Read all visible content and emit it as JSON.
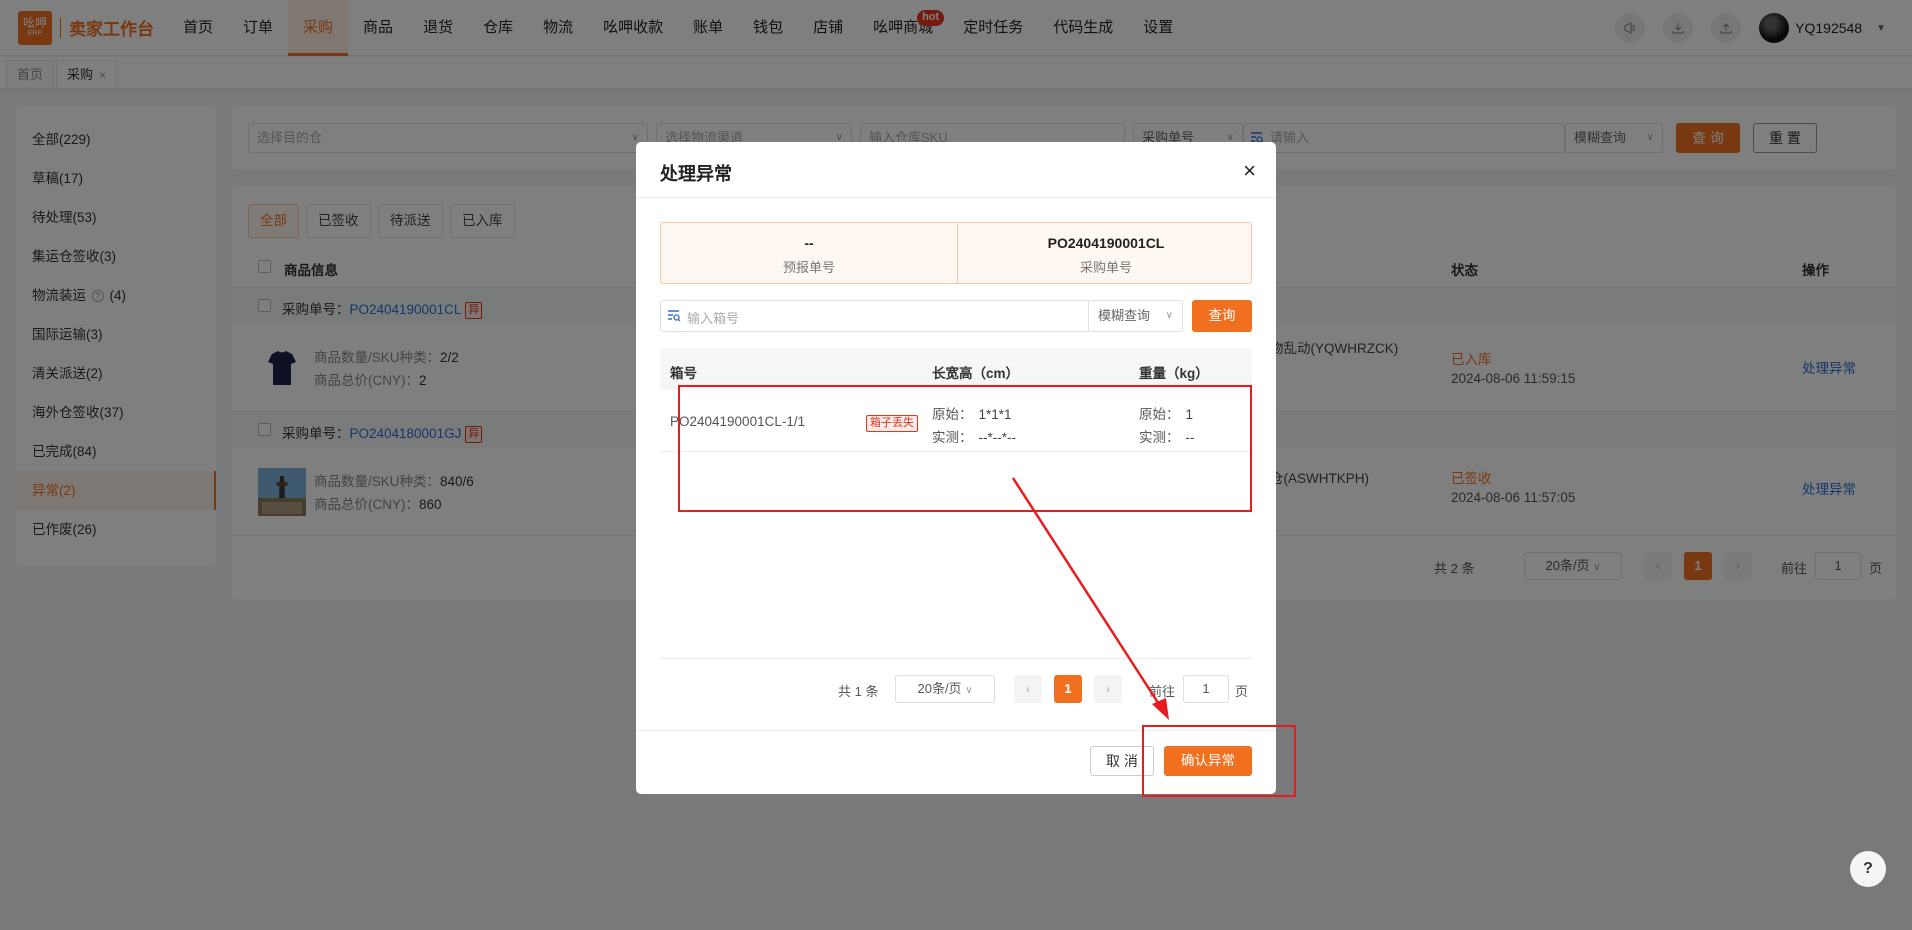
{
  "app": {
    "logo_main": "吆呷",
    "logo_sub": "ERP",
    "title": "卖家工作台"
  },
  "nav": {
    "items": [
      {
        "label": "首页",
        "active": false
      },
      {
        "label": "订单",
        "active": false
      },
      {
        "label": "采购",
        "active": true
      },
      {
        "label": "商品",
        "active": false
      },
      {
        "label": "退货",
        "active": false
      },
      {
        "label": "仓库",
        "active": false
      },
      {
        "label": "物流",
        "active": false
      },
      {
        "label": "吆呷收款",
        "active": false
      },
      {
        "label": "账单",
        "active": false
      },
      {
        "label": "钱包",
        "active": false
      },
      {
        "label": "店铺",
        "active": false
      },
      {
        "label": "吆呷商城",
        "active": false,
        "badge": "hot"
      },
      {
        "label": "定时任务",
        "active": false
      },
      {
        "label": "代码生成",
        "active": false
      },
      {
        "label": "设置",
        "active": false
      }
    ],
    "username": "YQ192548"
  },
  "pagetabs": [
    {
      "label": "首页",
      "closable": false
    },
    {
      "label": "采购",
      "closable": true,
      "close_glyph": "×"
    }
  ],
  "sidebar": {
    "items": [
      {
        "label": "全部(229)"
      },
      {
        "label": "草稿(17)"
      },
      {
        "label": "待处理(53)"
      },
      {
        "label": "集运仓签收(3)"
      },
      {
        "label": "物流装运",
        "suffix": "(4)",
        "help": "?"
      },
      {
        "label": "国际运输(3)"
      },
      {
        "label": "清关派送(2)"
      },
      {
        "label": "海外仓签收(37)"
      },
      {
        "label": "已完成(84)"
      },
      {
        "label": "异常(2)",
        "active": true
      },
      {
        "label": "已作废(26)"
      }
    ]
  },
  "filters": {
    "warehouse_placeholder": "选择目的仓",
    "channel_placeholder": "选择物流渠道",
    "sku_placeholder": "输入仓库SKU",
    "order_type": "采购单号",
    "keyword_placeholder": "请输入",
    "match_mode": "模糊查询",
    "query_button": "查 询",
    "reset_button": "重 置"
  },
  "status_tabs": [
    "全部",
    "已签收",
    "待派送",
    "已入库"
  ],
  "table": {
    "headers": {
      "product": "商品信息",
      "status": "状态",
      "ops": "操作"
    },
    "groups": [
      {
        "po_label": "采购单号：",
        "po_number": "PO2404190001CL",
        "flag": "异",
        "qty_label": "商品数量/SKU种类：",
        "qty_value": "2/2",
        "price_label": "商品总价(CNY)：",
        "price_value": "2",
        "warehouse": "物乱动(YQWHRZCK)",
        "status": "已入库",
        "date": "2024-08-06 11:59:15",
        "action": "处理异常"
      },
      {
        "po_label": "采购单号：",
        "po_number": "PO2404180001GJ",
        "flag": "异",
        "qty_label": "商品数量/SKU种类：",
        "qty_value": "840/6",
        "price_label": "商品总价(CNY)：",
        "price_value": "860",
        "warehouse": "仓(ASWHTKPH)",
        "status": "已签收",
        "date": "2024-08-06 11:57:05",
        "action": "处理异常"
      }
    ],
    "pagination": {
      "total": "共 2 条",
      "page_size": "20条/页",
      "current": "1",
      "goto_label": "前往",
      "goto_value": "1",
      "page_suffix": "页"
    }
  },
  "modal": {
    "title": "处理异常",
    "close_glyph": "×",
    "info": [
      {
        "value": "--",
        "label": "预报单号"
      },
      {
        "value": "PO2404190001CL",
        "label": "采购单号"
      }
    ],
    "search_placeholder": "输入箱号",
    "match_mode": "模糊查询",
    "query_button": "查询",
    "headers": {
      "box": "箱号",
      "dims": "长宽高（cm）",
      "weight": "重量（kg）"
    },
    "rows": [
      {
        "box_no": "PO2404190001CL-1/1",
        "badge": "箱子丢失",
        "dims_orig_label": "原始：",
        "dims_orig": "1*1*1",
        "dims_meas_label": "实测：",
        "dims_meas": "--*--*--",
        "w_orig_label": "原始：",
        "w_orig": "1",
        "w_meas_label": "实测：",
        "w_meas": "--"
      }
    ],
    "pagination": {
      "total": "共 1 条",
      "page_size": "20条/页",
      "current": "1",
      "goto_label": "前往",
      "goto_value": "1",
      "page_suffix": "页"
    },
    "cancel_button": "取 消",
    "confirm_button": "确认异常"
  },
  "help_button": "?",
  "colors": {
    "accent": "#f07020",
    "link": "#2f6dd6",
    "danger": "#e81c1c"
  }
}
